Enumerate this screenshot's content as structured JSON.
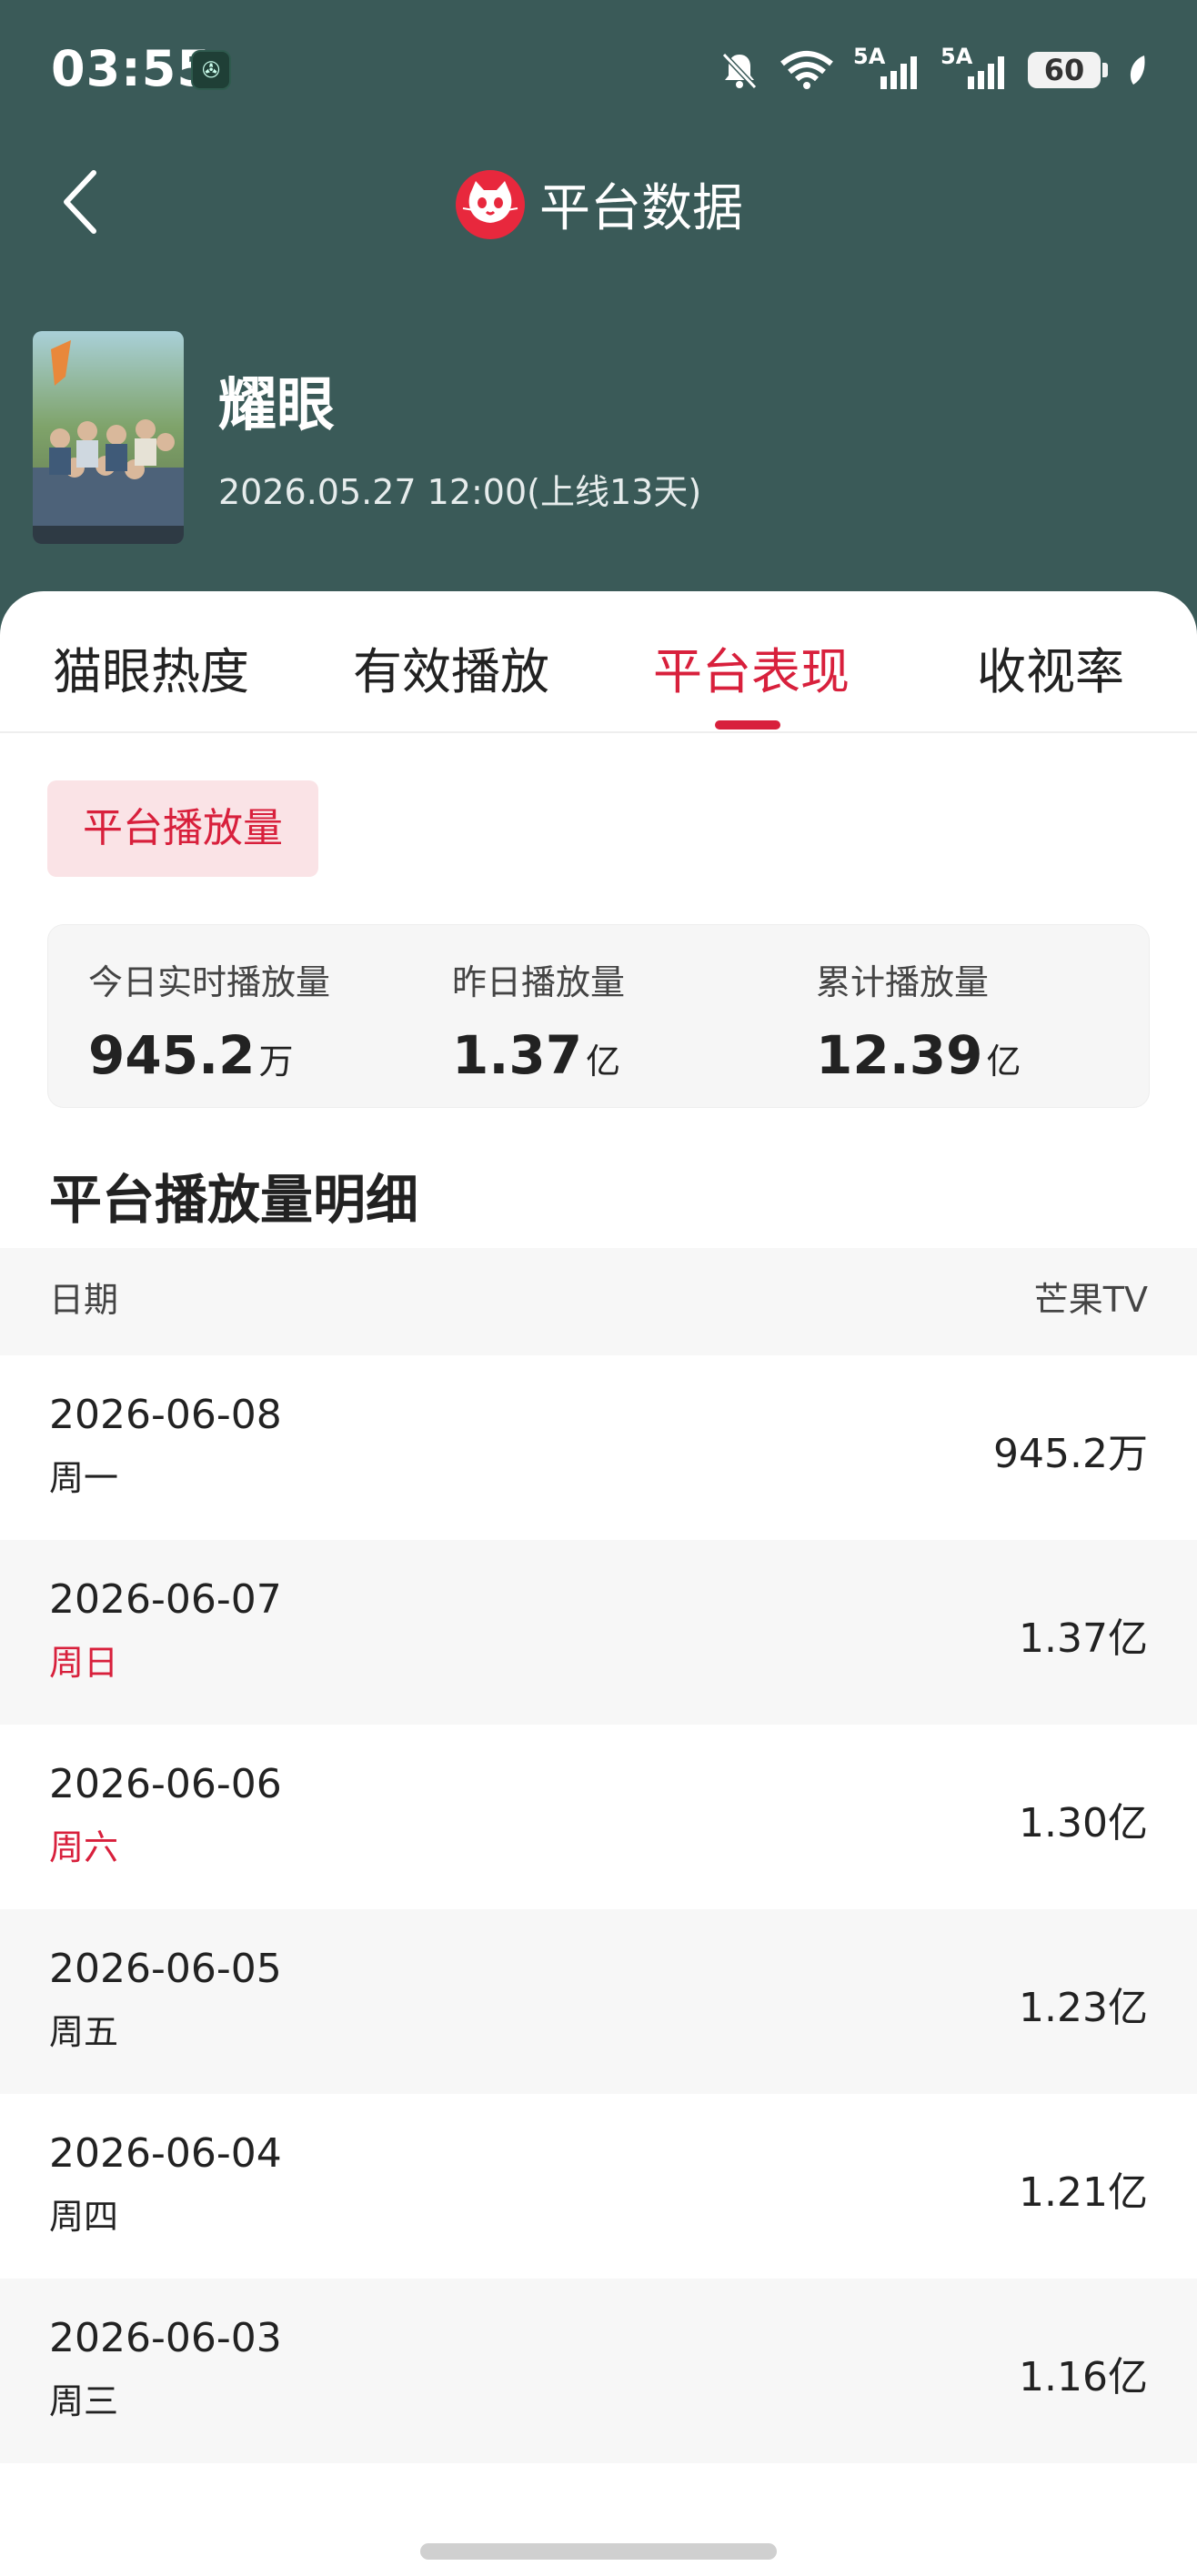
{
  "status_bar": {
    "time": "03:55",
    "app_badge": "✇",
    "net1": "5A",
    "net2": "5A",
    "battery": "60"
  },
  "nav": {
    "title": "平台数据"
  },
  "show": {
    "title": "耀眼",
    "subtitle": "2026.05.27 12:00(上线13天)"
  },
  "tabs": [
    {
      "label": "猫眼热度"
    },
    {
      "label": "有效播放"
    },
    {
      "label": "平台表现"
    },
    {
      "label": "收视率"
    }
  ],
  "chip": {
    "label": "平台播放量"
  },
  "summary": [
    {
      "label": "今日实时播放量",
      "value": "945.2",
      "unit": "万"
    },
    {
      "label": "昨日播放量",
      "value": "1.37",
      "unit": "亿"
    },
    {
      "label": "累计播放量",
      "value": "12.39",
      "unit": "亿"
    }
  ],
  "detail": {
    "title": "平台播放量明细",
    "col_date": "日期",
    "col_platform": "芒果TV",
    "rows": [
      {
        "date": "2026-06-08",
        "weekday": "周一",
        "value": "945.2万"
      },
      {
        "date": "2026-06-07",
        "weekday": "周日",
        "value": "1.37亿"
      },
      {
        "date": "2026-06-06",
        "weekday": "周六",
        "value": "1.30亿"
      },
      {
        "date": "2026-06-05",
        "weekday": "周五",
        "value": "1.23亿"
      },
      {
        "date": "2026-06-04",
        "weekday": "周四",
        "value": "1.21亿"
      },
      {
        "date": "2026-06-03",
        "weekday": "周三",
        "value": "1.16亿"
      }
    ]
  },
  "colors": {
    "header_bg": "#3a5a58",
    "accent": "#d8203c",
    "chip_bg": "#fae3e6"
  }
}
